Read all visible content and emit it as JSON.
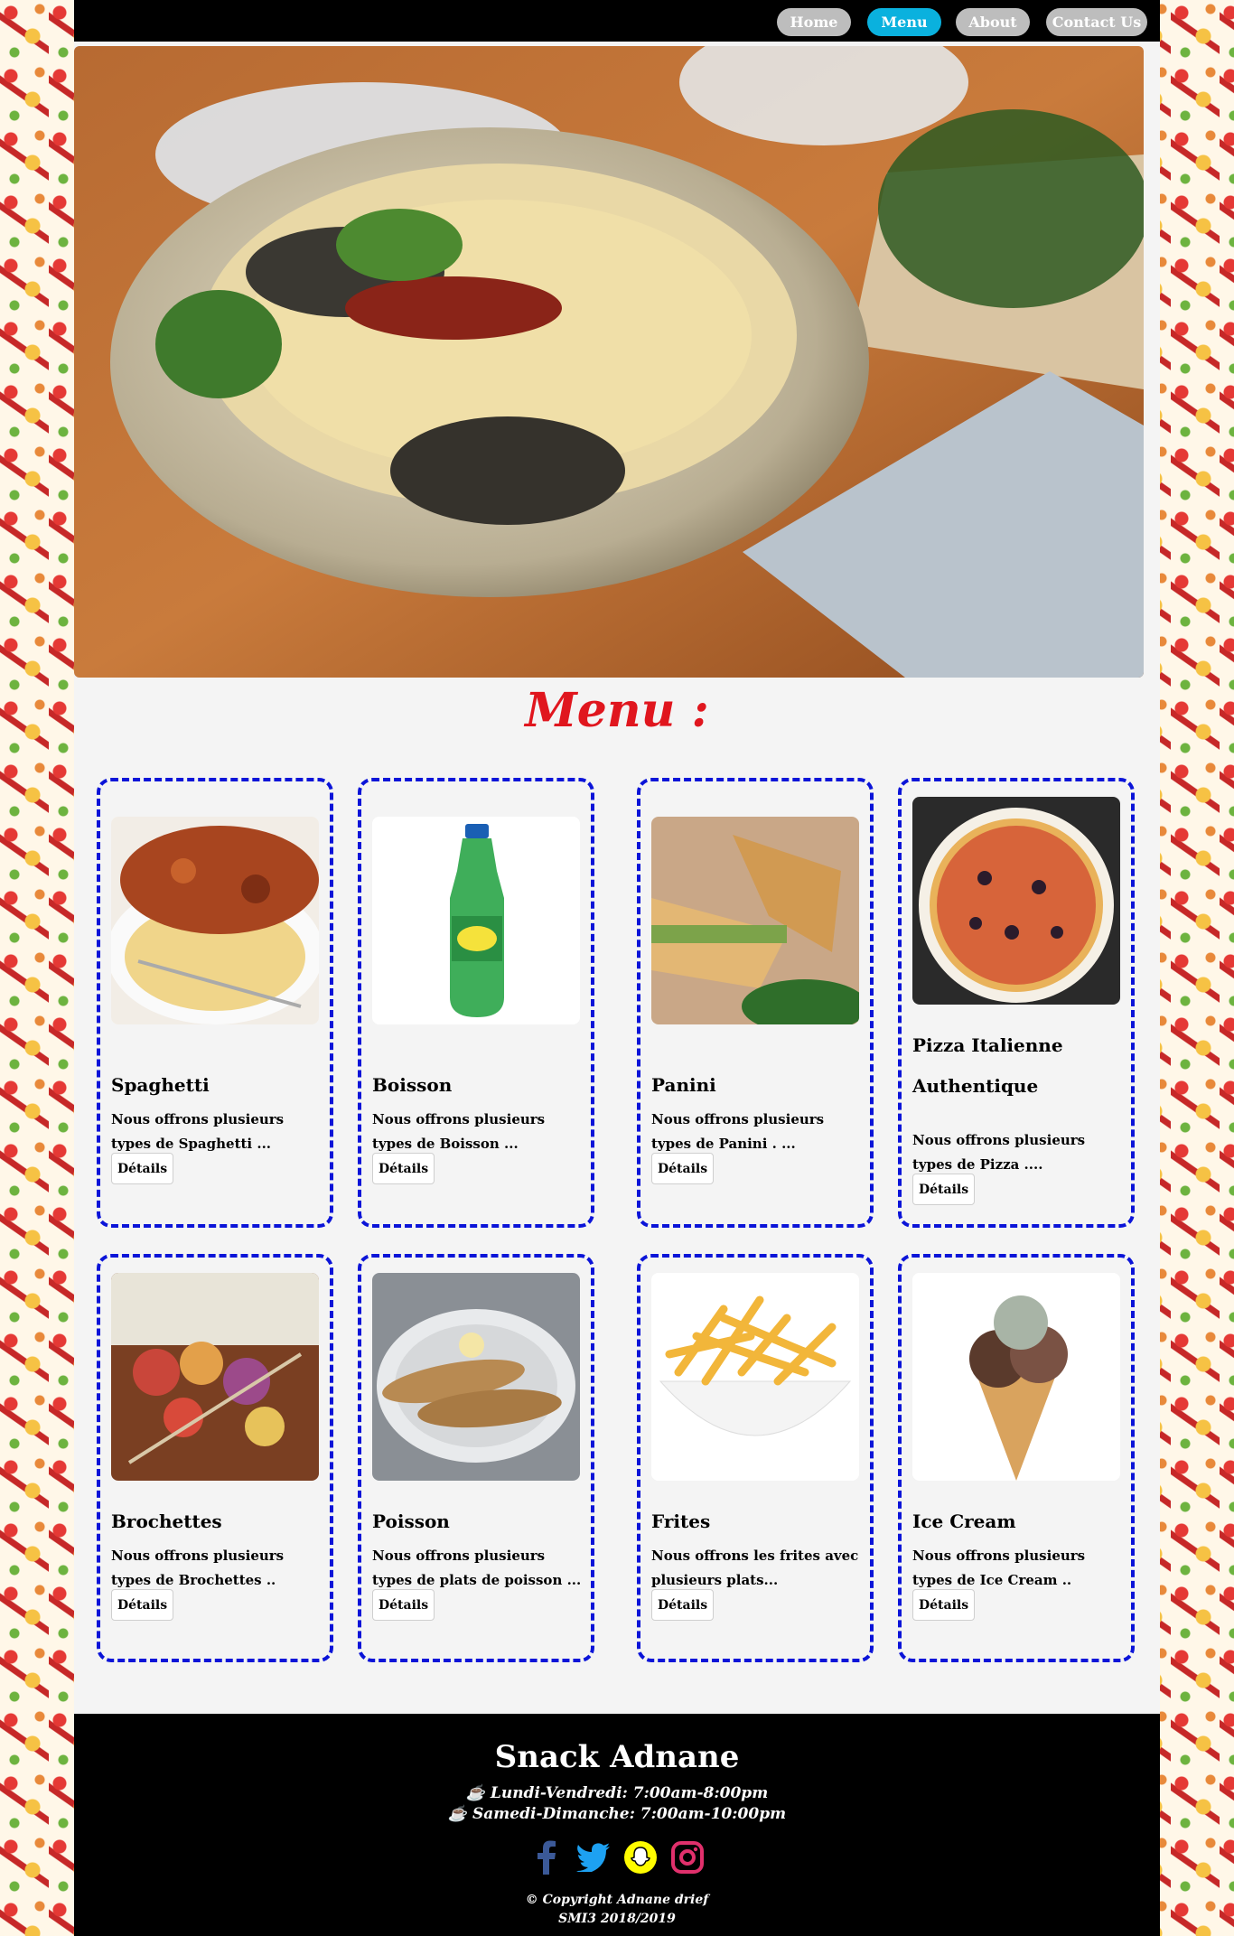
{
  "nav": {
    "home": "Home",
    "menu": "Menu",
    "about": "About",
    "contact": "Contact Us"
  },
  "menu_title": "Menu :",
  "cards": [
    {
      "title": "Spaghetti",
      "desc": "Nous offrons plusieurs types de Spaghetti ...",
      "button": "Détails"
    },
    {
      "title": "Boisson",
      "desc": "Nous offrons plusieurs types de Boisson ...",
      "button": "Détails"
    },
    {
      "title": "Panini",
      "desc": "Nous offrons plusieurs types de Panini . ...",
      "button": "Détails"
    },
    {
      "title": "Pizza Italienne Authentique",
      "desc": "Nous offrons plusieurs types de Pizza ....",
      "button": "Détails"
    },
    {
      "title": "Brochettes",
      "desc": "Nous offrons plusieurs types de Brochettes ..",
      "button": "Détails"
    },
    {
      "title": "Poisson",
      "desc": "Nous offrons plusieurs types de plats de poisson ...",
      "button": "Détails"
    },
    {
      "title": "Frites",
      "desc": "Nous offrons les frites avec plusieurs plats...",
      "button": "Détails"
    },
    {
      "title": "Ice Cream",
      "desc": "Nous offrons plusieurs types de Ice Cream ..",
      "button": "Détails"
    }
  ],
  "footer": {
    "title": "Snack Adnane",
    "hours_weekday": "☕ Lundi-Vendredi: 7:00am-8:00pm",
    "hours_weekend": "☕ Samedi-Dimanche: 7:00am-10:00pm",
    "copyright": "© Copyright Adnane drief",
    "class_year": "SMI3 2018/2019"
  },
  "icons": [
    "facebook-icon",
    "twitter-icon",
    "snapchat-icon",
    "instagram-icon"
  ],
  "colors": {
    "nav_active": "#0ab1de",
    "nav_inactive": "#bdbdbd",
    "menu_title": "#e0161e",
    "card_border": "#0b14d8",
    "facebook": "#3b5998",
    "twitter": "#1da1f2",
    "snapchat": "#fffc00",
    "instagram": "#e1306c"
  }
}
